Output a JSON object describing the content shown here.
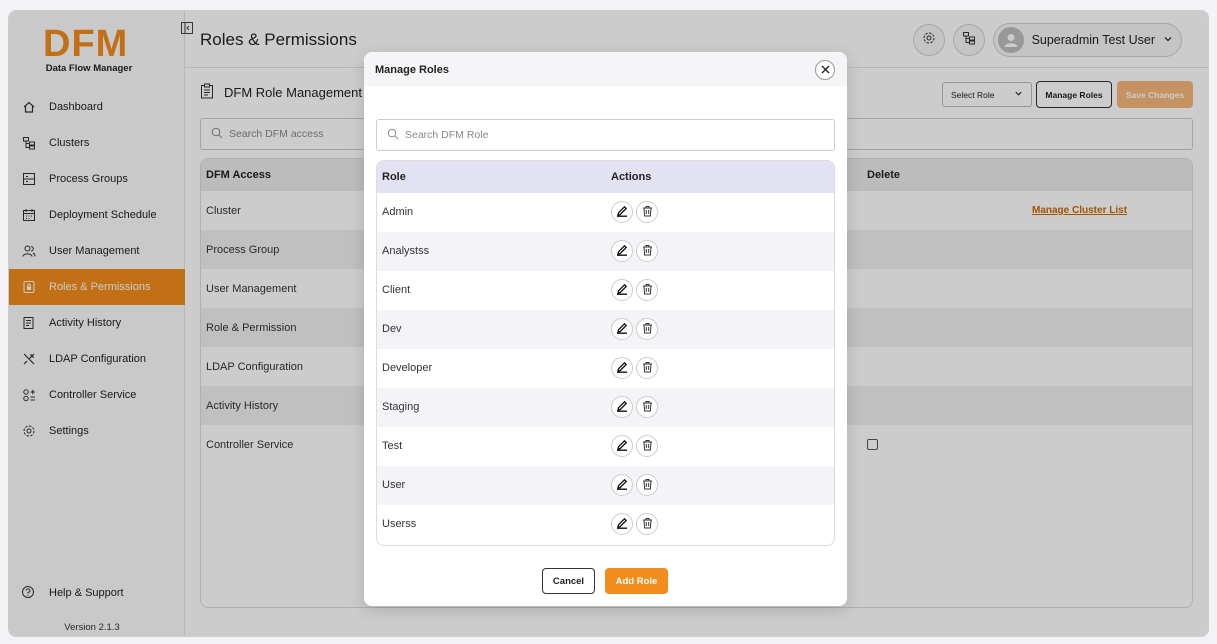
{
  "app": {
    "logo_text": "DFM",
    "logo_subtitle": "Data Flow Manager",
    "brand_color": "#f28c1c",
    "version": "Version 2.1.3"
  },
  "sidebar": {
    "items": [
      {
        "label": "Dashboard",
        "icon": "home-icon"
      },
      {
        "label": "Clusters",
        "icon": "cluster-tree-icon"
      },
      {
        "label": "Process Groups",
        "icon": "process-groups-icon"
      },
      {
        "label": "Deployment Schedule",
        "icon": "calendar-icon"
      },
      {
        "label": "User Management",
        "icon": "users-icon"
      },
      {
        "label": "Roles & Permissions",
        "icon": "lock-file-icon",
        "active": true
      },
      {
        "label": "Activity History",
        "icon": "history-icon"
      },
      {
        "label": "LDAP Configuration",
        "icon": "tools-icon"
      },
      {
        "label": "Controller Service",
        "icon": "services-icon"
      },
      {
        "label": "Settings",
        "icon": "gear-icon"
      }
    ],
    "help_label": "Help & Support"
  },
  "header": {
    "title": "Roles & Permissions",
    "user_name": "Superadmin Test User"
  },
  "content": {
    "subtitle": "DFM Role Management",
    "select_role_placeholder": "Select Role",
    "manage_roles_label": "Manage Roles",
    "save_changes_label": "Save Changes",
    "search_placeholder": "Search DFM access",
    "table": {
      "col_access": "DFM Access",
      "col_delete": "Delete",
      "rows": [
        "Cluster",
        "Process Group",
        "User Management",
        "Role & Permission",
        "LDAP Configuration",
        "Activity History",
        "Controller Service"
      ],
      "manage_cluster_link": "Manage Cluster List"
    }
  },
  "modal": {
    "title": "Manage Roles",
    "search_placeholder": "Search DFM Role",
    "col_role": "Role",
    "col_actions": "Actions",
    "roles": [
      "Admin",
      "Analystss",
      "Client",
      "Dev",
      "Developer",
      "Staging",
      "Test",
      "User",
      "Userss"
    ],
    "cancel_label": "Cancel",
    "add_label": "Add Role"
  }
}
